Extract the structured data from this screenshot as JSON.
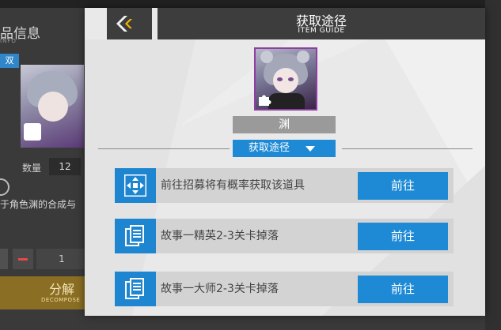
{
  "background": {
    "title": "品信息",
    "title_sub": "INFO",
    "tag": "双",
    "qty_label": "数量",
    "qty_value": "12",
    "description": "于角色渊的合成与",
    "stepper_value": "1",
    "decompose_label": "分解",
    "decompose_sub": "DECOMPOSE"
  },
  "dialog": {
    "title": "获取途径",
    "subtitle": "ITEM GUIDE",
    "item_name": "渊",
    "guide_tab_label": "获取途径",
    "routes": [
      {
        "text": "前往招募将有概率获取该道具",
        "icon": "recruit-icon",
        "button": "前往"
      },
      {
        "text": "故事一精英2-3关卡掉落",
        "icon": "document-icon",
        "button": "前往"
      },
      {
        "text": "故事一大师2-3关卡掉落",
        "icon": "document-icon",
        "button": "前往"
      }
    ]
  },
  "colors": {
    "accent_blue": "#1e8ad6",
    "header_dark": "#3d3d3d",
    "panel_bg": "#e9e9e9",
    "route_bg": "#d3d3d3",
    "rarity_border": "#8e3ea0",
    "decompose_gold": "#8a6e24"
  }
}
